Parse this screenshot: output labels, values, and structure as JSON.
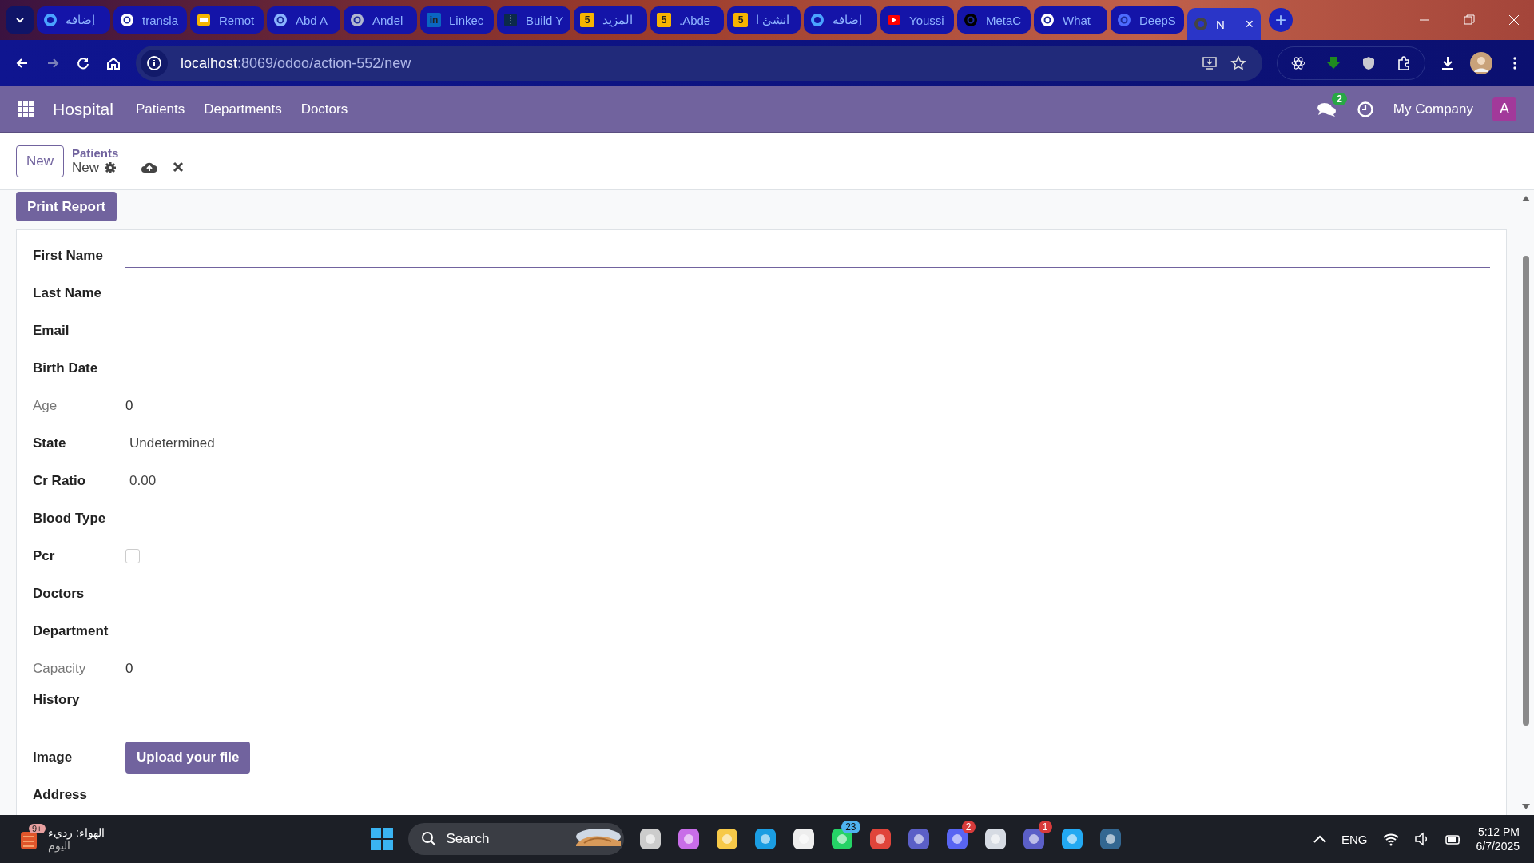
{
  "browser": {
    "tabs": [
      {
        "title": "إضافة",
        "kind": "ring",
        "selected": false
      },
      {
        "title": "transla",
        "kind": "google",
        "selected": false
      },
      {
        "title": "Remot",
        "kind": "slides",
        "selected": false
      },
      {
        "title": "Abd A",
        "kind": "at",
        "selected": false
      },
      {
        "title": "Andel",
        "kind": "globe",
        "selected": false
      },
      {
        "title": "Linkec",
        "kind": "square",
        "icon_text": "in",
        "selected": false
      },
      {
        "title": "Build Y",
        "kind": "dark",
        "selected": false
      },
      {
        "title": "المزيد",
        "kind": "square5",
        "icon_text": "5",
        "selected": false
      },
      {
        "title": ".Abde",
        "kind": "square5",
        "icon_text": "5",
        "selected": false
      },
      {
        "title": "انشئ ا",
        "kind": "square5",
        "icon_text": "5",
        "selected": false
      },
      {
        "title": "إضافة",
        "kind": "ring",
        "selected": false
      },
      {
        "title": "Youssi",
        "kind": "play",
        "selected": false
      },
      {
        "title": "MetaC",
        "kind": "knot",
        "selected": false
      },
      {
        "title": "What",
        "kind": "knot_white",
        "selected": false
      },
      {
        "title": "DeepS",
        "kind": "whale",
        "selected": false
      },
      {
        "title": "N",
        "kind": "loading",
        "selected": true
      }
    ],
    "close_tab": "✕",
    "new_tab": "+",
    "address": {
      "host": "localhost",
      "path": ":8069/odoo/action-552/new"
    }
  },
  "navbar": {
    "app": "Hospital",
    "menu": [
      "Patients",
      "Departments",
      "Doctors"
    ],
    "chat_count": "2",
    "company": "My Company",
    "avatar": "A"
  },
  "control_panel": {
    "new_button": "New",
    "breadcrumb": "Patients",
    "record": "New"
  },
  "form": {
    "print_button": "Print Report",
    "fields": [
      {
        "label": "First Name",
        "kind": "focused_input",
        "readonly": false
      },
      {
        "label": "Last Name",
        "kind": "input",
        "readonly": false
      },
      {
        "label": "Email",
        "kind": "input",
        "readonly": false
      },
      {
        "label": "Birth Date",
        "kind": "input",
        "readonly": false
      },
      {
        "label": "Age",
        "kind": "text",
        "value": "0",
        "readonly": true
      },
      {
        "label": "State",
        "kind": "select",
        "value": "Undetermined",
        "readonly": false
      },
      {
        "label": "Cr Ratio",
        "kind": "select",
        "value": "0.00",
        "readonly": false
      },
      {
        "label": "Blood Type",
        "kind": "input",
        "readonly": false
      },
      {
        "label": "Pcr",
        "kind": "checkbox",
        "checked": false,
        "readonly": false
      },
      {
        "label": "Doctors",
        "kind": "input",
        "readonly": false
      },
      {
        "label": "Department",
        "kind": "input",
        "readonly": false
      },
      {
        "label": "Capacity",
        "kind": "text",
        "value": "0",
        "readonly": true
      },
      {
        "label": "History",
        "kind": "textarea",
        "readonly": false
      },
      {
        "label": "Image",
        "kind": "upload",
        "value": "Upload your file",
        "readonly": false
      },
      {
        "label": "Address",
        "kind": "input",
        "readonly": false
      }
    ]
  },
  "taskbar": {
    "weather": "الهواء: رديء",
    "weather_sub": "اليوم",
    "weather_badge": "9+",
    "search": "Search",
    "apps": [
      {
        "kind": "stack"
      },
      {
        "kind": "copilot"
      },
      {
        "kind": "folder"
      },
      {
        "kind": "edge"
      },
      {
        "kind": "store"
      },
      {
        "kind": "whatsapp",
        "badge": "23"
      },
      {
        "kind": "chrome"
      },
      {
        "kind": "teams"
      },
      {
        "kind": "discord",
        "badge": "2"
      },
      {
        "kind": "gear"
      },
      {
        "kind": "teams2",
        "badge": "1"
      },
      {
        "kind": "vscode"
      },
      {
        "kind": "elephant"
      }
    ],
    "lang": "ENG",
    "time": "5:12 PM",
    "date": "6/7/2025"
  }
}
